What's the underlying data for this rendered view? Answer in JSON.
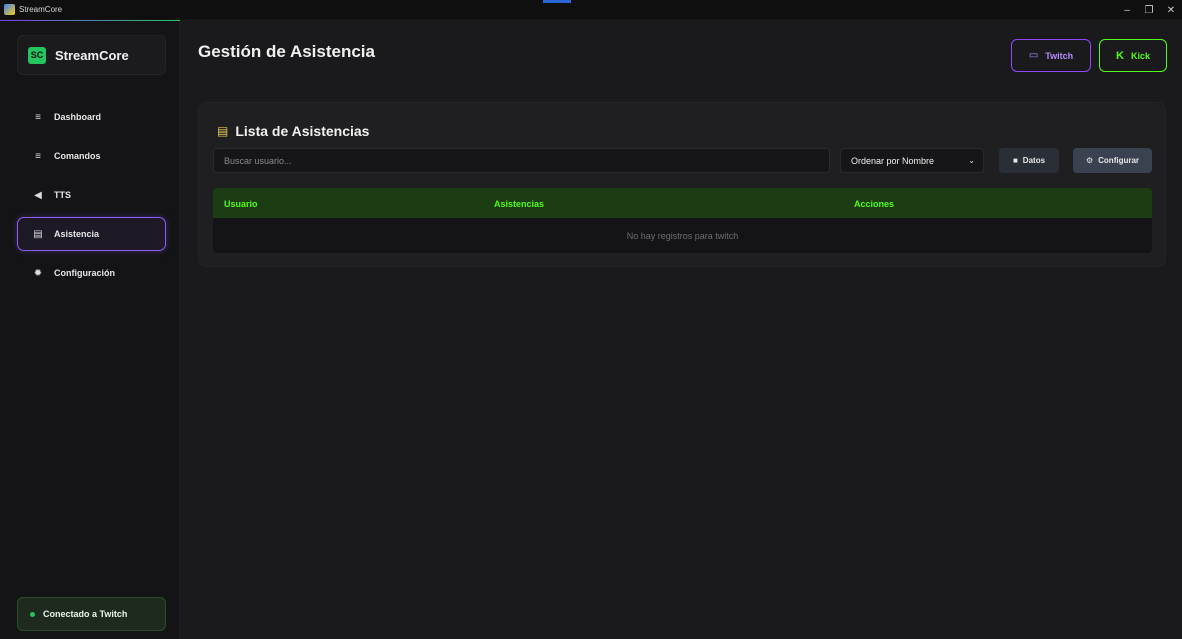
{
  "window": {
    "title": "StreamCore",
    "minimize": "–",
    "maximize": "❐",
    "close": "✕"
  },
  "sidebar": {
    "brand_logo": "SC",
    "brand_name": "StreamCore",
    "items": [
      {
        "label": "Dashboard",
        "icon": "≡",
        "icon_name": "menu-icon"
      },
      {
        "label": "Comandos",
        "icon": "≡",
        "icon_name": "list-icon"
      },
      {
        "label": "TTS",
        "icon": "◀",
        "icon_name": "speaker-icon"
      },
      {
        "label": "Asistencia",
        "icon": "▤",
        "icon_name": "clipboard-icon",
        "active": true
      },
      {
        "label": "Configuración",
        "icon": "✹",
        "icon_name": "gear-icon"
      }
    ],
    "status": "Conectado a Twitch"
  },
  "header": {
    "title": "Gestión de Asistencia",
    "twitch_label": "Twitch",
    "twitch_icon": "▭",
    "kick_label": "Kick",
    "kick_icon": "K"
  },
  "attendance": {
    "title": "Lista de Asistencias",
    "title_icon": "▤",
    "search_placeholder": "Buscar usuario...",
    "sort_value": "Ordenar por Nombre",
    "sort_chevron": "⌄",
    "datos_label": "Datos",
    "datos_icon": "■",
    "config_label": "Configurar",
    "config_icon": "⚙",
    "columns": [
      "Usuario",
      "Asistencias",
      "Acciones"
    ],
    "empty_message": "No hay registros para twitch"
  },
  "colors": {
    "accent_purple": "#9146ff",
    "accent_green": "#53fc18",
    "brand_green": "#22c55e"
  }
}
